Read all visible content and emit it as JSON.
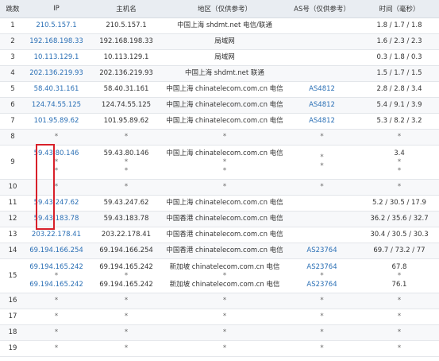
{
  "headers": [
    "跳数",
    "IP",
    "主机名",
    "地区（仅供参考）",
    "AS号（仅供参考）",
    "时间（毫秒）"
  ],
  "rows": [
    {
      "hop": "1",
      "ip": [
        "210.5.157.1"
      ],
      "host": [
        "210.5.157.1"
      ],
      "loc": [
        "中国上海 shdmt.net 电信/联通"
      ],
      "as": [
        ""
      ],
      "time": [
        "1.8 / 1.7 / 1.8"
      ]
    },
    {
      "hop": "2",
      "ip": [
        "192.168.198.33"
      ],
      "host": [
        "192.168.198.33"
      ],
      "loc": [
        "局域网"
      ],
      "as": [
        ""
      ],
      "time": [
        "1.6 / 2.3 / 2.3"
      ]
    },
    {
      "hop": "3",
      "ip": [
        "10.113.129.1"
      ],
      "host": [
        "10.113.129.1"
      ],
      "loc": [
        "局域网"
      ],
      "as": [
        ""
      ],
      "time": [
        "0.3 / 1.8 / 0.3"
      ]
    },
    {
      "hop": "4",
      "ip": [
        "202.136.219.93"
      ],
      "host": [
        "202.136.219.93"
      ],
      "loc": [
        "中国上海 shdmt.net 联通"
      ],
      "as": [
        ""
      ],
      "time": [
        "1.5 / 1.7 / 1.5"
      ]
    },
    {
      "hop": "5",
      "ip": [
        "58.40.31.161"
      ],
      "host": [
        "58.40.31.161"
      ],
      "loc": [
        "中国上海 chinatelecom.com.cn 电信"
      ],
      "as": [
        "AS4812"
      ],
      "time": [
        "2.8 / 2.8 / 3.4"
      ]
    },
    {
      "hop": "6",
      "ip": [
        "124.74.55.125"
      ],
      "host": [
        "124.74.55.125"
      ],
      "loc": [
        "中国上海 chinatelecom.com.cn 电信"
      ],
      "as": [
        "AS4812"
      ],
      "time": [
        "5.4 / 9.1 / 3.9"
      ]
    },
    {
      "hop": "7",
      "ip": [
        "101.95.89.62"
      ],
      "host": [
        "101.95.89.62"
      ],
      "loc": [
        "中国上海 chinatelecom.com.cn 电信"
      ],
      "as": [
        "AS4812"
      ],
      "time": [
        "5.3 / 8.2 / 3.2"
      ]
    },
    {
      "hop": "8",
      "ip": [
        "*"
      ],
      "host": [
        "*"
      ],
      "loc": [
        "*"
      ],
      "as": [
        "*"
      ],
      "time": [
        "*"
      ]
    },
    {
      "hop": "9",
      "ip": [
        "59.43.80.146",
        "*",
        "*"
      ],
      "host": [
        "59.43.80.146",
        "*",
        "*"
      ],
      "loc": [
        "中国上海 chinatelecom.com.cn 电信",
        "*",
        "*"
      ],
      "as": [
        "",
        "*",
        "*"
      ],
      "time": [
        "3.4",
        "*",
        "*"
      ]
    },
    {
      "hop": "10",
      "ip": [
        "*"
      ],
      "host": [
        "*"
      ],
      "loc": [
        "*"
      ],
      "as": [
        "*"
      ],
      "time": [
        "*"
      ]
    },
    {
      "hop": "11",
      "ip": [
        "59.43.247.62"
      ],
      "host": [
        "59.43.247.62"
      ],
      "loc": [
        "中国上海 chinatelecom.com.cn 电信"
      ],
      "as": [
        ""
      ],
      "time": [
        "5.2 / 30.5 / 17.9"
      ]
    },
    {
      "hop": "12",
      "ip": [
        "59.43.183.78"
      ],
      "host": [
        "59.43.183.78"
      ],
      "loc": [
        "中国香港 chinatelecom.com.cn 电信"
      ],
      "as": [
        ""
      ],
      "time": [
        "36.2 / 35.6 / 32.7"
      ]
    },
    {
      "hop": "13",
      "ip": [
        "203.22.178.41"
      ],
      "host": [
        "203.22.178.41"
      ],
      "loc": [
        "中国香港 chinatelecom.com.cn 电信"
      ],
      "as": [
        ""
      ],
      "time": [
        "30.4 / 30.5 / 30.3"
      ]
    },
    {
      "hop": "14",
      "ip": [
        "69.194.166.254"
      ],
      "host": [
        "69.194.166.254"
      ],
      "loc": [
        "中国香港 chinatelecom.com.cn 电信"
      ],
      "as": [
        "AS23764"
      ],
      "time": [
        "69.7 / 73.2 / 77"
      ]
    },
    {
      "hop": "15",
      "ip": [
        "69.194.165.242",
        "*",
        "69.194.165.242"
      ],
      "host": [
        "69.194.165.242",
        "*",
        "69.194.165.242"
      ],
      "loc": [
        "新加坡 chinatelecom.com.cn 电信",
        "*",
        "新加坡 chinatelecom.com.cn 电信"
      ],
      "as": [
        "AS23764",
        "*",
        "AS23764"
      ],
      "time": [
        "67.8",
        "*",
        "76.1"
      ]
    },
    {
      "hop": "16",
      "ip": [
        "*"
      ],
      "host": [
        "*"
      ],
      "loc": [
        "*"
      ],
      "as": [
        "*"
      ],
      "time": [
        "*"
      ]
    },
    {
      "hop": "17",
      "ip": [
        "*"
      ],
      "host": [
        "*"
      ],
      "loc": [
        "*"
      ],
      "as": [
        "*"
      ],
      "time": [
        "*"
      ]
    },
    {
      "hop": "18",
      "ip": [
        "*"
      ],
      "host": [
        "*"
      ],
      "loc": [
        "*"
      ],
      "as": [
        "*"
      ],
      "time": [
        "*"
      ]
    },
    {
      "hop": "19",
      "ip": [
        "*"
      ],
      "host": [
        "*"
      ],
      "loc": [
        "*"
      ],
      "as": [
        "*"
      ],
      "time": [
        "*"
      ]
    }
  ],
  "colors": {
    "header_bg": "#e9edf2",
    "link": "#2a6fb5",
    "highlight": "#d8202a"
  }
}
